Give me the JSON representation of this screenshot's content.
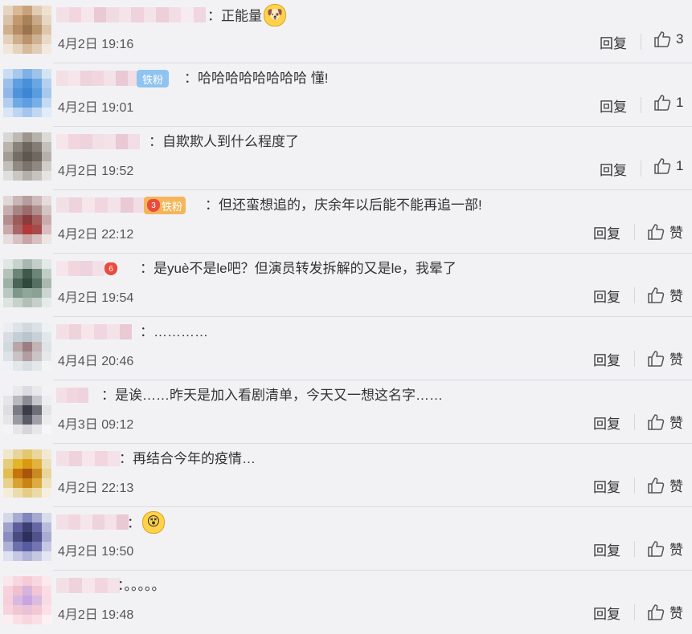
{
  "comments": [
    {
      "text": "：正能量",
      "emoji": "doge",
      "time": "4月2日 19:16",
      "reply": "回复",
      "likes": "3",
      "avatar": [
        "#e6d4c0",
        "#d9b896",
        "#c9a27b",
        "#e2cdb4",
        "#efe0cf",
        "#d8c2a8",
        "#c39a6f",
        "#a98258",
        "#c8a988",
        "#e6d6c2",
        "#ceb08e",
        "#b58c64",
        "#9a744e",
        "#b8936b",
        "#ddc7ab",
        "#e4d1ba",
        "#cfae8a",
        "#bb936d",
        "#cdb192",
        "#e9dac7",
        "#f1e6da",
        "#e5d3bd",
        "#d6bb9a",
        "#e1cdb5",
        "#f2e9df"
      ],
      "name": [
        "#f3e0e6",
        "#f1d6df",
        "#f6e6ec",
        "#e9c9d4",
        "#f0dbe3",
        "#f5e3ea",
        "#eed2dc",
        "#f4e2e9",
        "#eccfd9",
        "#f2dde5",
        "#f7eaf0",
        "#efd6df"
      ]
    },
    {
      "text": "：哈哈哈哈哈哈哈哈 懂!",
      "badge": "铁粉",
      "time": "4月2日 19:01",
      "reply": "回复",
      "likes": "1",
      "avatar": [
        "#c9dcf2",
        "#a8c8ec",
        "#7fb1e6",
        "#9ec3ea",
        "#d5e4f5",
        "#9cc0ea",
        "#5f9ee0",
        "#4a90d9",
        "#6aa6e2",
        "#b4d0ef",
        "#8fb8e8",
        "#4f94db",
        "#3d86d4",
        "#5a9ddf",
        "#a6c8ed",
        "#b2cdee",
        "#6fa9e3",
        "#5c9ee0",
        "#78afe5",
        "#c4daf3",
        "#d8e6f6",
        "#bcd5f1",
        "#a4c5ec",
        "#c0d8f2",
        "#e0ecf8"
      ],
      "name": [
        "#f3e0e6",
        "#f6e6ec",
        "#eed2dc",
        "#f1d6df",
        "#f4e2e9",
        "#e9c9d4",
        "#f2dde5",
        "#f5e3ea",
        "#eccfd9",
        "#f0dbe3",
        "#f7eaf0",
        "#efd6df",
        "#f3e0e6",
        "#f1d6df",
        "#f6e6ec",
        "#eed2dc",
        "#f4e2e9",
        "#e9c9d4",
        "#f2dde5",
        "#f5e3ea",
        "#eccfd9",
        "#f0dbe3",
        "#f7eaf0",
        "#efd6df"
      ]
    },
    {
      "text": "：自欺欺人到什么程度了",
      "time": "4月2日 19:52",
      "reply": "回复",
      "likes": "1",
      "avatar": [
        "#d9d7d4",
        "#bdb9b4",
        "#9c968f",
        "#b7b2ab",
        "#dcdad7",
        "#b9b4ae",
        "#8a837b",
        "#6d665f",
        "#857d75",
        "#c4c0bb",
        "#a49d95",
        "#756e66",
        "#5e5750",
        "#6f6861",
        "#b5b0aa",
        "#c2beb9",
        "#918a83",
        "#7a736c",
        "#8f8881",
        "#d0cdca",
        "#e1dfdd",
        "#cac7c3",
        "#b4afa9",
        "#c7c3bf",
        "#e6e4e2"
      ],
      "name": [
        "#f6e6ec",
        "#f1d6df",
        "#eed2dc",
        "#f3e0e6",
        "#f4e2e9",
        "#e9c9d4",
        "#f2dde5",
        "#f5e3ea",
        "#eccfd9",
        "#f0dbe3",
        "#f7eaf0",
        "#efd6df",
        "#f3e0e6",
        "#f1d6df",
        "#f6e6ec",
        "#eed2dc",
        "#f4e2e9",
        "#e9c9d4"
      ]
    },
    {
      "text": "：但还蛮想追的，庆余年以后能不能再追一部!",
      "badge": "铁粉",
      "badge_level": "3",
      "time": "4月2日 22:12",
      "reply": "回复",
      "likes": "赞",
      "avatar": [
        "#e2d6d6",
        "#c9b6b6",
        "#b79d9d",
        "#cdbaba",
        "#e6dcdc",
        "#c4aeae",
        "#a88585",
        "#9a6d6d",
        "#b08f8f",
        "#d4c4c4",
        "#b48f8f",
        "#9c5c5c",
        "#8a3c3c",
        "#a45f5f",
        "#c9abab",
        "#c9a9a9",
        "#a86666",
        "#b23a3a",
        "#a94a4a",
        "#d8bebe",
        "#e8dcdc",
        "#d6c2c2",
        "#c8a6a6",
        "#d7c0c0",
        "#eee4e4"
      ],
      "name": [
        "#f3e0e6",
        "#eed2dc",
        "#f6e6ec",
        "#f1d6df",
        "#f4e2e9",
        "#e9c9d4",
        "#f2dde5",
        "#f5e3ea",
        "#eccfd9",
        "#f0dbe3",
        "#f7eaf0",
        "#efd6df",
        "#f3e0e6",
        "#f1d6df",
        "#f6e6ec",
        "#eed2dc",
        "#f4e2e9",
        "#e9c9d4",
        "#f2dde5",
        "#f5e3ea",
        "#eccfd9",
        "#f0dbe3",
        "#f7eaf0"
      ]
    },
    {
      "text": "：是yuè不是le吧？但演员转发拆解的又是le，我晕了",
      "badge_level": "6",
      "time": "4月2日 19:54",
      "reply": "回复",
      "likes": "赞",
      "avatar": [
        "#e0e6e3",
        "#c7d2cc",
        "#a9b8af",
        "#c2cec7",
        "#e3e9e6",
        "#b3c3ba",
        "#6f8479",
        "#3f5a4c",
        "#6d8478",
        "#c0cdc6",
        "#9fb1a7",
        "#4a6557",
        "#2f4a3c",
        "#557062",
        "#a8bab0",
        "#b9c8c0",
        "#7f968a",
        "#8fa79a",
        "#8ba194",
        "#cbd6d0",
        "#dde4e0",
        "#c6d2cb",
        "#b1c1b8",
        "#c4d0c9",
        "#e5ebe8"
      ],
      "name": [
        "#f6e6ec",
        "#f1d6df",
        "#eed2dc",
        "#f3e0e6",
        "#f4e2e9",
        "#e9c9d4",
        "#f2dde5",
        "#f5e3ea",
        "#eccfd9",
        "#f0dbe3",
        "#f7eaf0",
        "#efd6df",
        "#f3e0e6",
        "#f1d6df",
        "#f6e6ec",
        "#eed2dc"
      ]
    },
    {
      "text": "：…………",
      "time": "4月4日 20:46",
      "reply": "回复",
      "likes": "赞",
      "avatar": [
        "#ebeef0",
        "#dde3e7",
        "#d1d9de",
        "#dbe2e6",
        "#eef1f3",
        "#d7dee3",
        "#c4ced5",
        "#b9c4cc",
        "#c7d1d7",
        "#e2e7ea",
        "#d1d9df",
        "#b8a6a8",
        "#9c7f83",
        "#c3b3b5",
        "#dde3e7",
        "#dce2e6",
        "#c9c2c4",
        "#b29da0",
        "#cbc3c5",
        "#e5e9ec",
        "#eff2f4",
        "#e2e7ea",
        "#d8dfe3",
        "#e3e8eb",
        "#f2f4f6"
      ],
      "name": [
        "#f3e0e6",
        "#eed2dc",
        "#f6e6ec",
        "#f1d6df",
        "#f4e2e9",
        "#e9c9d4",
        "#f2f2f5",
        "#f5e3ea",
        "#eccfd9",
        "#f0dbe3",
        "#f7eaf0",
        "#efd6df",
        "#f3e0e6",
        "#f1d6df",
        "#f6e6ec",
        "#eed2dc",
        "#f4e2e9"
      ]
    },
    {
      "text": "：是诶……昨天是加入看剧清单，今天又一想这名字……",
      "time": "4月3日 09:12",
      "reply": "回复",
      "likes": "赞",
      "avatar": [
        "#f2f2f4",
        "#e9e9ec",
        "#dcdce0",
        "#e9e9ec",
        "#f3f3f5",
        "#e6e6e9",
        "#b9b9c0",
        "#8c8c96",
        "#c6c6cc",
        "#eeeef0",
        "#dedee2",
        "#7b7b86",
        "#3c3c48",
        "#6d6d78",
        "#e3e3e6",
        "#e6e6e9",
        "#9a9aa3",
        "#5c5c68",
        "#a0a0a8",
        "#ececef",
        "#f4f4f6",
        "#e6e6e9",
        "#d6d6da",
        "#e7e7ea",
        "#f6f6f8"
      ],
      "name": [
        "#f3e0e6",
        "#f1d6df",
        "#eed2dc",
        "#f6e6ec",
        "#f4e2e9",
        "#e9c9d4",
        "#f2dde5",
        "#f5e3ea",
        "#eccfd9",
        "#f0dbe3",
        "#f7eaf0",
        "#efd6df",
        "#f3e0e6"
      ]
    },
    {
      "text": "：再结合今年的疫情…",
      "time": "4月2日 22:13",
      "reply": "回复",
      "likes": "赞",
      "avatar": [
        "#efe6cc",
        "#e7d59e",
        "#e3c76f",
        "#ead79b",
        "#f1e9d3",
        "#e6cd7c",
        "#e3b52a",
        "#d99a12",
        "#e2b33e",
        "#ece0b7",
        "#e2bd4f",
        "#c7750e",
        "#a8560c",
        "#c98a21",
        "#e9d49a",
        "#e8d18c",
        "#d9a233",
        "#c98417",
        "#dcac42",
        "#efe2bc",
        "#f3ecd8",
        "#ecdcac",
        "#e6cd86",
        "#ecdaa6",
        "#f5efdf"
      ],
      "name": [
        "#f3e0e6",
        "#eed2dc",
        "#f6e6ec",
        "#f1d6df",
        "#f4e2e9",
        "#e9c9d4",
        "#f2dde5",
        "#f5e3ea",
        "#eccfd9",
        "#f0dbe3",
        "#f7eaf0",
        "#efd6df",
        "#f3e0e6",
        "#f1d6df",
        "#f6e6ec",
        "#eed2dc",
        "#f4e2e9",
        "#e9c9d4"
      ]
    },
    {
      "text": "：",
      "emoji": "dizzy",
      "time": "4月2日 19:50",
      "reply": "回复",
      "likes": "赞",
      "avatar": [
        "#d6d8ea",
        "#a9acd2",
        "#8286bf",
        "#a6a9d0",
        "#dadcec",
        "#9fa2cc",
        "#5c5f9c",
        "#3d3f70",
        "#6467a3",
        "#b8bbda",
        "#8a8dc0",
        "#4a4c80",
        "#2e2f5c",
        "#50538a",
        "#a8abd2",
        "#aeb1d6",
        "#6d70ad",
        "#585ba0",
        "#7275b1",
        "#c6c8e2",
        "#dfe0f0",
        "#c7c9e3",
        "#b1b3d8",
        "#c6c8e2",
        "#e4e5f2"
      ],
      "name": [
        "#f3e0e6",
        "#f1d6df",
        "#f6e6ec",
        "#eed2dc",
        "#f4e2e9",
        "#e9c9d4",
        "#f2dde5",
        "#f5e3ea",
        "#eccfd9",
        "#f0dbe3",
        "#f7eaf0",
        "#efd6df",
        "#f3e0e6",
        "#f1d6df",
        "#f6e6ec",
        "#eed2dc",
        "#f4e2e9",
        "#e9c9d4",
        "#f2dde5",
        "#f5e3ea"
      ]
    },
    {
      "text": "：。。。。。",
      "time": "4月2日 19:48",
      "reply": "回复",
      "likes": "赞",
      "avatar": [
        "#fbe6ec",
        "#f8d6df",
        "#f6cbd6",
        "#f8d8e0",
        "#fce9ee",
        "#f7d2dc",
        "#efc0cf",
        "#d6b4dc",
        "#f2c6d3",
        "#fadde4",
        "#f6cfd9",
        "#d9b8e2",
        "#c9a6e0",
        "#dcbbe0",
        "#f9dbe3",
        "#f7d4dd",
        "#f0c6d3",
        "#e9c2d8",
        "#f2c8d4",
        "#fbe1e7",
        "#fdedf1",
        "#fadfe6",
        "#f8d6df",
        "#fadfe6",
        "#fef1f4"
      ],
      "name": [
        "#f3e0e6",
        "#eed2dc",
        "#f6e6ec",
        "#f1d6df",
        "#f4e2e9",
        "#e9c9d4",
        "#f2dde5",
        "#f5e3ea",
        "#eccfd9",
        "#f0dbe3",
        "#f7eaf0",
        "#efd6df",
        "#f3e0e6",
        "#f1d6df",
        "#f6e6ec",
        "#eed2dc",
        "#f4e2e9",
        "#e9c9d4",
        "#f2dde5"
      ]
    }
  ]
}
